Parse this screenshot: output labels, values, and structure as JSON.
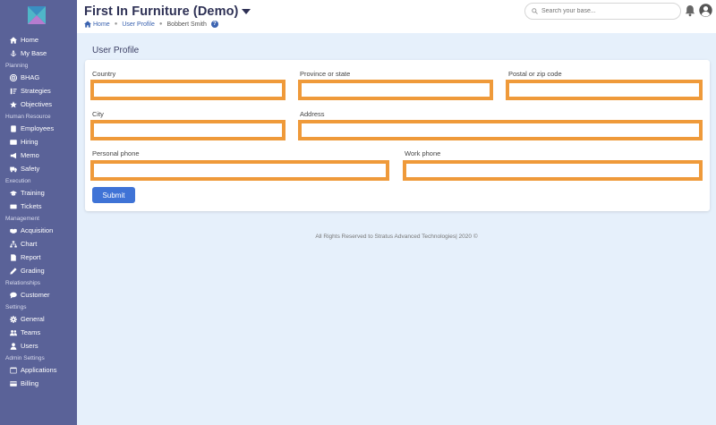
{
  "header": {
    "title": "First In Furniture (Demo)",
    "breadcrumb": {
      "home": "Home",
      "section": "User Profile",
      "current": "Bobbert Smith"
    },
    "search_placeholder": "Search your base..."
  },
  "sidebar": {
    "items": [
      {
        "type": "item",
        "label": "Home",
        "icon": "home-icon"
      },
      {
        "type": "item",
        "label": "My Base",
        "icon": "anchor-icon"
      },
      {
        "type": "section",
        "label": "Planning"
      },
      {
        "type": "item",
        "label": "BHAG",
        "icon": "target-icon"
      },
      {
        "type": "item",
        "label": "Strategies",
        "icon": "sort-icon"
      },
      {
        "type": "item",
        "label": "Objectives",
        "icon": "star-icon"
      },
      {
        "type": "section",
        "label": "Human Resource"
      },
      {
        "type": "item",
        "label": "Employees",
        "icon": "id-badge-icon"
      },
      {
        "type": "item",
        "label": "Hiring",
        "icon": "id-card-icon"
      },
      {
        "type": "item",
        "label": "Memo",
        "icon": "megaphone-icon"
      },
      {
        "type": "item",
        "label": "Safety",
        "icon": "truck-icon"
      },
      {
        "type": "section",
        "label": "Execution"
      },
      {
        "type": "item",
        "label": "Training",
        "icon": "graduation-cap-icon"
      },
      {
        "type": "item",
        "label": "Tickets",
        "icon": "ticket-icon"
      },
      {
        "type": "section",
        "label": "Management"
      },
      {
        "type": "item",
        "label": "Acquisition",
        "icon": "handshake-icon"
      },
      {
        "type": "item",
        "label": "Chart",
        "icon": "org-chart-icon"
      },
      {
        "type": "item",
        "label": "Report",
        "icon": "report-icon"
      },
      {
        "type": "item",
        "label": "Grading",
        "icon": "pen-icon"
      },
      {
        "type": "section",
        "label": "Relationships"
      },
      {
        "type": "item",
        "label": "Customer",
        "icon": "chat-icon"
      },
      {
        "type": "section",
        "label": "Settings"
      },
      {
        "type": "item",
        "label": "General",
        "icon": "gear-icon"
      },
      {
        "type": "item",
        "label": "Teams",
        "icon": "users-icon"
      },
      {
        "type": "item",
        "label": "Users",
        "icon": "user-icon"
      },
      {
        "type": "section",
        "label": "Admin Settings"
      },
      {
        "type": "item",
        "label": "Applications",
        "icon": "window-icon"
      },
      {
        "type": "item",
        "label": "Billing",
        "icon": "credit-card-icon"
      }
    ]
  },
  "main": {
    "section_title": "User Profile",
    "fields": {
      "country": {
        "label": "Country",
        "value": ""
      },
      "province": {
        "label": "Province or state",
        "value": ""
      },
      "postal": {
        "label": "Postal or zip code",
        "value": ""
      },
      "city": {
        "label": "City",
        "value": ""
      },
      "address": {
        "label": "Address",
        "value": ""
      },
      "personal_phone": {
        "label": "Personal phone",
        "value": ""
      },
      "work_phone": {
        "label": "Work phone",
        "value": ""
      }
    },
    "submit_label": "Submit"
  },
  "footer": {
    "text": "All Rights Reserved to Stratus Advanced Technologies| 2020 ©"
  },
  "colors": {
    "sidebar": "#5a6298",
    "accent": "#3f73d6",
    "field_highlight": "#ef9a3a",
    "title": "#2e3155"
  }
}
